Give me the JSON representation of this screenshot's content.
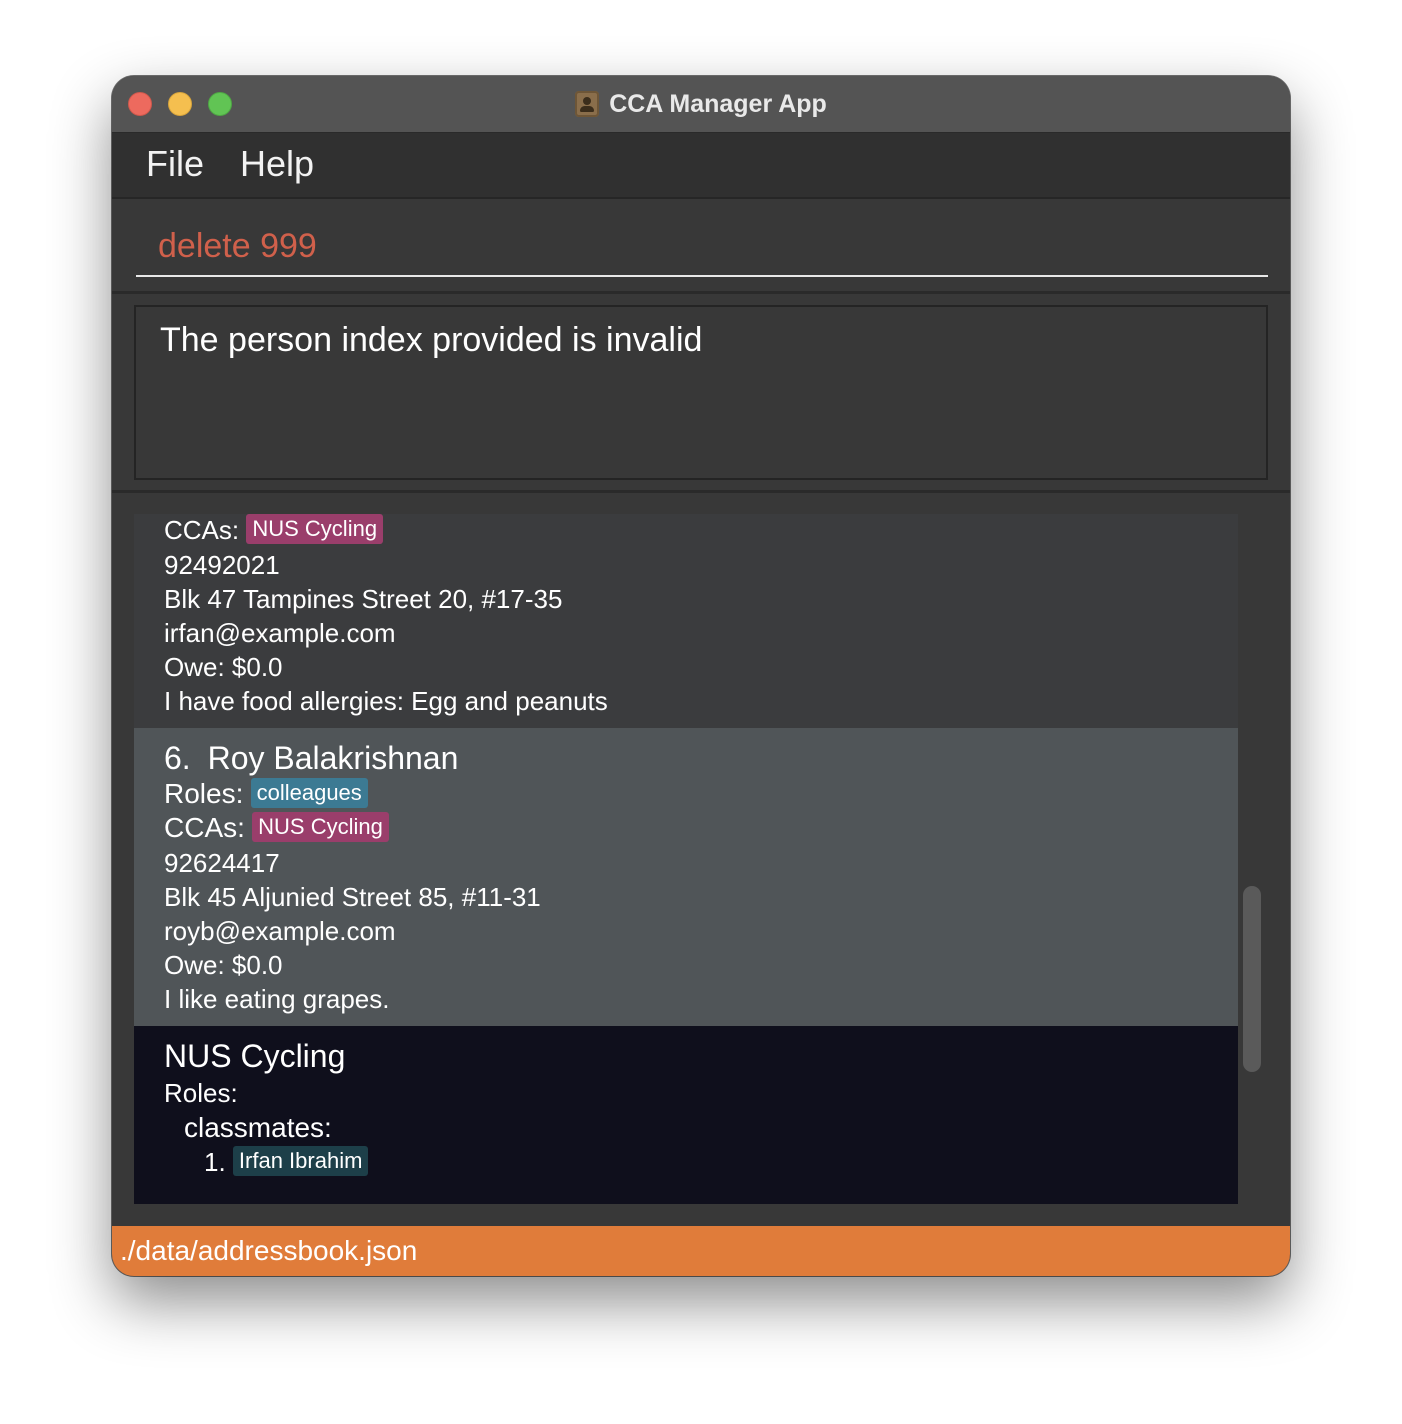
{
  "window": {
    "title": "CCA Manager App"
  },
  "menu": {
    "file_label": "File",
    "help_label": "Help"
  },
  "command": {
    "value": "delete 999"
  },
  "result": {
    "message": "The person index provided is invalid"
  },
  "list": {
    "partial_card": {
      "ccas_label": "CCAs:",
      "ccas": [
        "NUS Cycling"
      ],
      "phone": "92492021",
      "address": "Blk 47 Tampines Street 20, #17-35",
      "email": "irfan@example.com",
      "owe": "Owe: $0.0",
      "remark": "I have food allergies: Egg and peanuts"
    },
    "selected_card": {
      "index": "6.",
      "name": "Roy Balakrishnan",
      "roles_label": "Roles:",
      "roles": [
        "colleagues"
      ],
      "ccas_label": "CCAs:",
      "ccas": [
        "NUS Cycling"
      ],
      "phone": "92624417",
      "address": "Blk 45 Aljunied Street 85, #11-31",
      "email": "royb@example.com",
      "owe": "Owe: $0.0",
      "remark": "I like eating grapes."
    },
    "cca_card": {
      "name": "NUS Cycling",
      "roles_label": "Roles:",
      "role_group": "classmates:",
      "member_index": "1.",
      "member_name": "Irfan Ibrahim"
    }
  },
  "status": {
    "path": "./data/addressbook.json"
  },
  "colors": {
    "accent_status": "#e07c3a",
    "cca_tag": "#9a3e6b",
    "role_tag": "#3c7a93",
    "error_text": "#d0604b"
  },
  "icons": {
    "app": "contacts-book-icon"
  }
}
